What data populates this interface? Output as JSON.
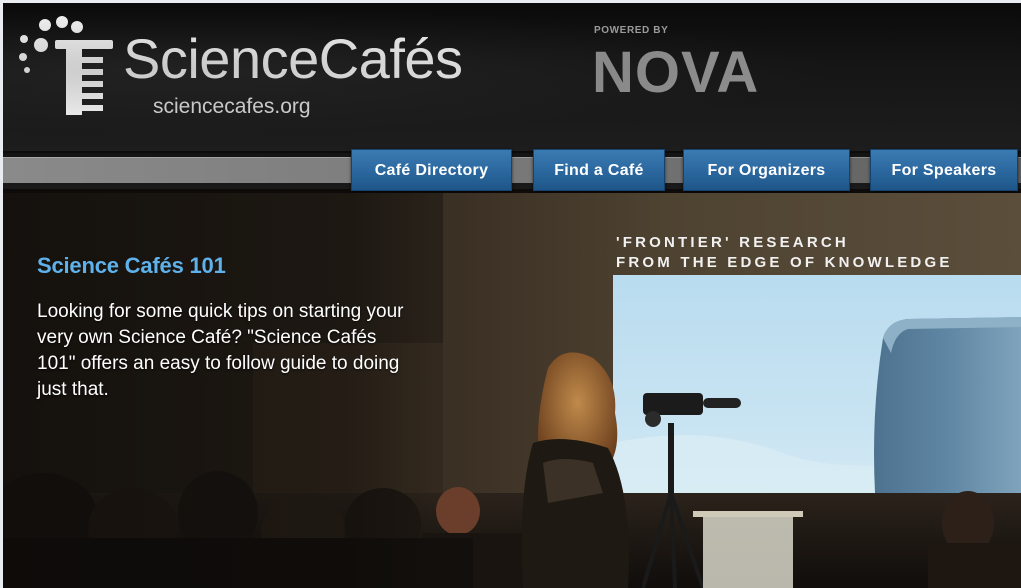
{
  "header": {
    "brand_name": "ScienceCafés",
    "brand_url": "sciencecafes.org",
    "powered_by": "POWERED BY",
    "partner_logo": "NOVA"
  },
  "nav": {
    "items": [
      {
        "label": "Café Directory"
      },
      {
        "label": "Find a Café"
      },
      {
        "label": "For Organizers"
      },
      {
        "label": "For Speakers"
      }
    ]
  },
  "hero": {
    "title": "Science Cafés 101",
    "body": "Looking for some quick tips on starting your very own Science Café? \"Science Cafés 101\" offers an easy to follow guide to doing just that.",
    "slide_caption_line1": "'FRONTIER' RESEARCH",
    "slide_caption_line2": "FROM THE EDGE OF KNOWLEDGE"
  },
  "colors": {
    "accent_title": "#5eb1ea",
    "nav_button": "#2a679e",
    "header_bg": "#111111"
  },
  "icons": [
    "science-cafes-logo-icon"
  ]
}
